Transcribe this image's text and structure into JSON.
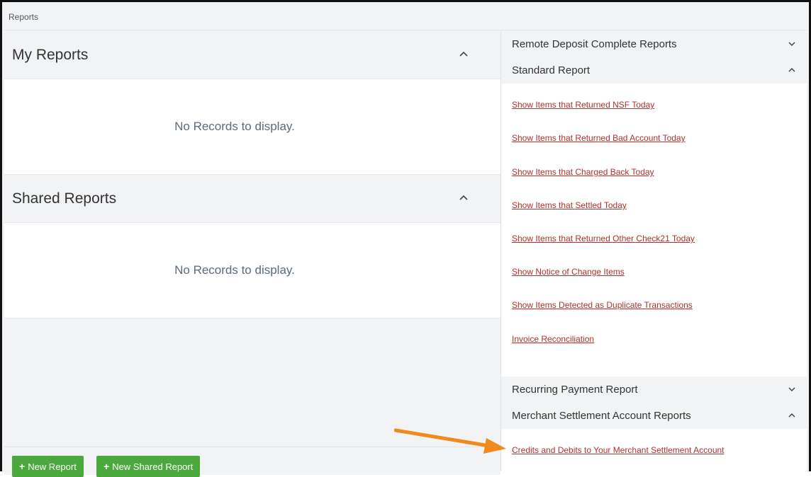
{
  "breadcrumb": "Reports",
  "left": {
    "my_reports": {
      "title": "My Reports",
      "empty_text": "No Records to display."
    },
    "shared_reports": {
      "title": "Shared Reports",
      "empty_text": "No Records to display."
    },
    "buttons": {
      "new_report": "New Report",
      "new_shared_report": "New Shared Report"
    }
  },
  "right": {
    "sections": [
      {
        "title": "Remote Deposit Complete Reports",
        "state": "collapsed",
        "chevron": "chevron-down-icon"
      },
      {
        "title": "Standard Report",
        "state": "expanded",
        "chevron": "chevron-up-icon"
      },
      {
        "title": "Recurring Payment Report",
        "state": "collapsed",
        "chevron": "chevron-down-icon"
      },
      {
        "title": "Merchant Settlement Account Reports",
        "state": "expanded",
        "chevron": "chevron-up-icon"
      }
    ],
    "standard_links": [
      "Show Items that Returned NSF Today",
      "Show Items that Returned Bad Account Today",
      "Show Items that Charged Back Today",
      "Show Items that Settled Today",
      "Show Items that Returned Other Check21 Today",
      "Show Notice of Change Items",
      "Show Items Detected as Duplicate Transactions",
      "Invoice Reconciliation"
    ],
    "merchant_links": [
      "Credits and Debits to Your Merchant Settlement Account"
    ]
  },
  "colors": {
    "link": "#b0312a",
    "button": "#4aa83c",
    "annotation_arrow": "#f08a1d"
  }
}
